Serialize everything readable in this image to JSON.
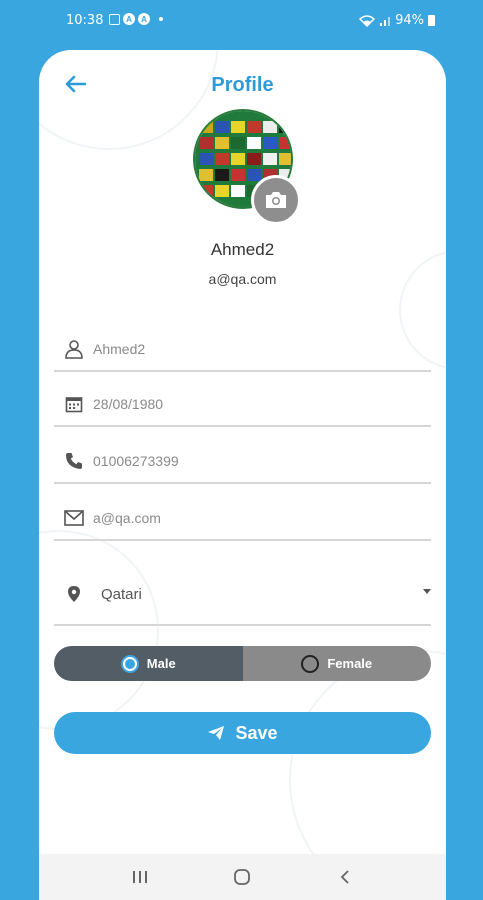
{
  "status_bar": {
    "time": "10:38",
    "battery": "94%",
    "icons": [
      "image-icon",
      "app-a-icon",
      "app-a-icon",
      "dot-icon",
      "wifi-icon",
      "signal-icon",
      "battery-icon"
    ]
  },
  "header": {
    "title": "Profile",
    "back_icon": "arrow-left-icon"
  },
  "profile": {
    "name": "Ahmed2",
    "email": "a@qa.com",
    "camera_icon": "camera-icon"
  },
  "form": {
    "name": {
      "icon": "user-icon",
      "value": "Ahmed2"
    },
    "dob": {
      "icon": "calendar-icon",
      "value": "28/08/1980"
    },
    "phone": {
      "icon": "phone-icon",
      "value": "01006273399"
    },
    "email": {
      "icon": "mail-icon",
      "value": "a@qa.com"
    },
    "nationality": {
      "icon": "location-pin-icon",
      "value": "Qatari"
    }
  },
  "gender": {
    "male_label": "Male",
    "female_label": "Female",
    "selected": "Male"
  },
  "save": {
    "label": "Save",
    "icon": "send-icon"
  },
  "colors": {
    "accent": "#3aa6e0",
    "title": "#2e9bd6",
    "male_bg": "#535d66",
    "female_bg": "#8a8a8a"
  }
}
